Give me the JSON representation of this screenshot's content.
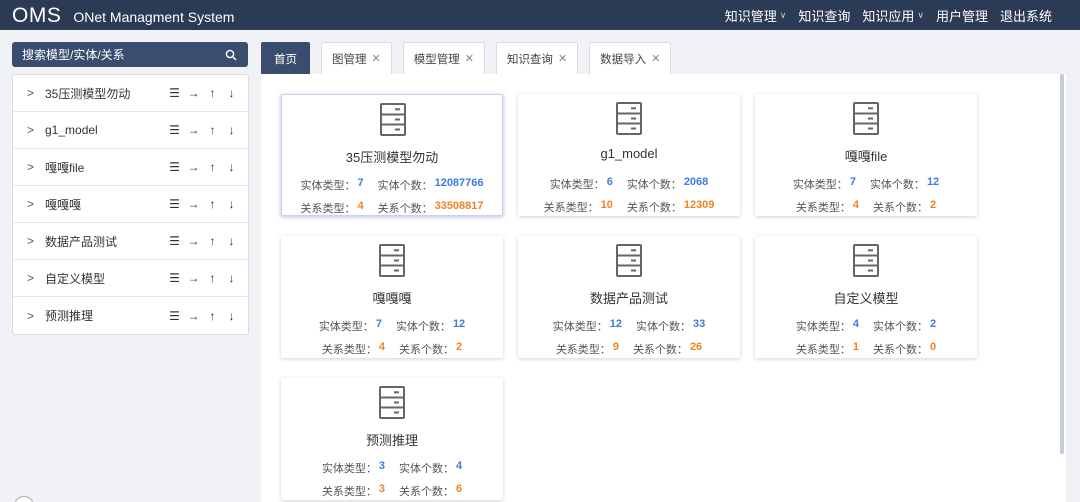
{
  "header": {
    "brand": "OMS",
    "subtitle": "ONet Managment System",
    "nav": [
      {
        "label": "知识管理",
        "dropdown": true
      },
      {
        "label": "知识查询",
        "dropdown": false
      },
      {
        "label": "知识应用",
        "dropdown": true
      },
      {
        "label": "用户管理",
        "dropdown": false
      },
      {
        "label": "退出系统",
        "dropdown": false
      }
    ]
  },
  "sidebar": {
    "search_label": "搜索模型/实体/关系",
    "items": [
      {
        "label": "35压测模型勿动"
      },
      {
        "label": "g1_model"
      },
      {
        "label": "嘎嘎file"
      },
      {
        "label": "嘎嘎嘎"
      },
      {
        "label": "数据产品测试"
      },
      {
        "label": "自定义模型"
      },
      {
        "label": "预测推理"
      }
    ]
  },
  "tabs": [
    {
      "label": "首页",
      "active": true,
      "closable": false
    },
    {
      "label": "图管理",
      "active": false,
      "closable": true
    },
    {
      "label": "模型管理",
      "active": false,
      "closable": true
    },
    {
      "label": "知识查询",
      "active": false,
      "closable": true
    },
    {
      "label": "数据导入",
      "active": false,
      "closable": true
    }
  ],
  "labels": {
    "entity_type": "实体类型：",
    "entity_count": "实体个数：",
    "relation_type": "关系类型：",
    "relation_count": "关系个数："
  },
  "cards": [
    {
      "title": "35压测模型勿动",
      "entity_type": "7",
      "entity_count": "12087766",
      "relation_type": "4",
      "relation_count": "33508817",
      "selected": true
    },
    {
      "title": "g1_model",
      "entity_type": "6",
      "entity_count": "2068",
      "relation_type": "10",
      "relation_count": "12309"
    },
    {
      "title": "嘎嘎file",
      "entity_type": "7",
      "entity_count": "12",
      "relation_type": "4",
      "relation_count": "2"
    },
    {
      "title": "嘎嘎嘎",
      "entity_type": "7",
      "entity_count": "12",
      "relation_type": "4",
      "relation_count": "2"
    },
    {
      "title": "数据产品测试",
      "entity_type": "12",
      "entity_count": "33",
      "relation_type": "9",
      "relation_count": "26"
    },
    {
      "title": "自定义模型",
      "entity_type": "4",
      "entity_count": "2",
      "relation_type": "1",
      "relation_count": "0"
    },
    {
      "title": "预测推理",
      "entity_type": "3",
      "entity_count": "4",
      "relation_type": "3",
      "relation_count": "6"
    }
  ],
  "colors": {
    "header_bg": "#2b3a55",
    "accent": "#3b4d6e",
    "value_blue": "#3d7bdf",
    "value_orange": "#f0831f"
  }
}
